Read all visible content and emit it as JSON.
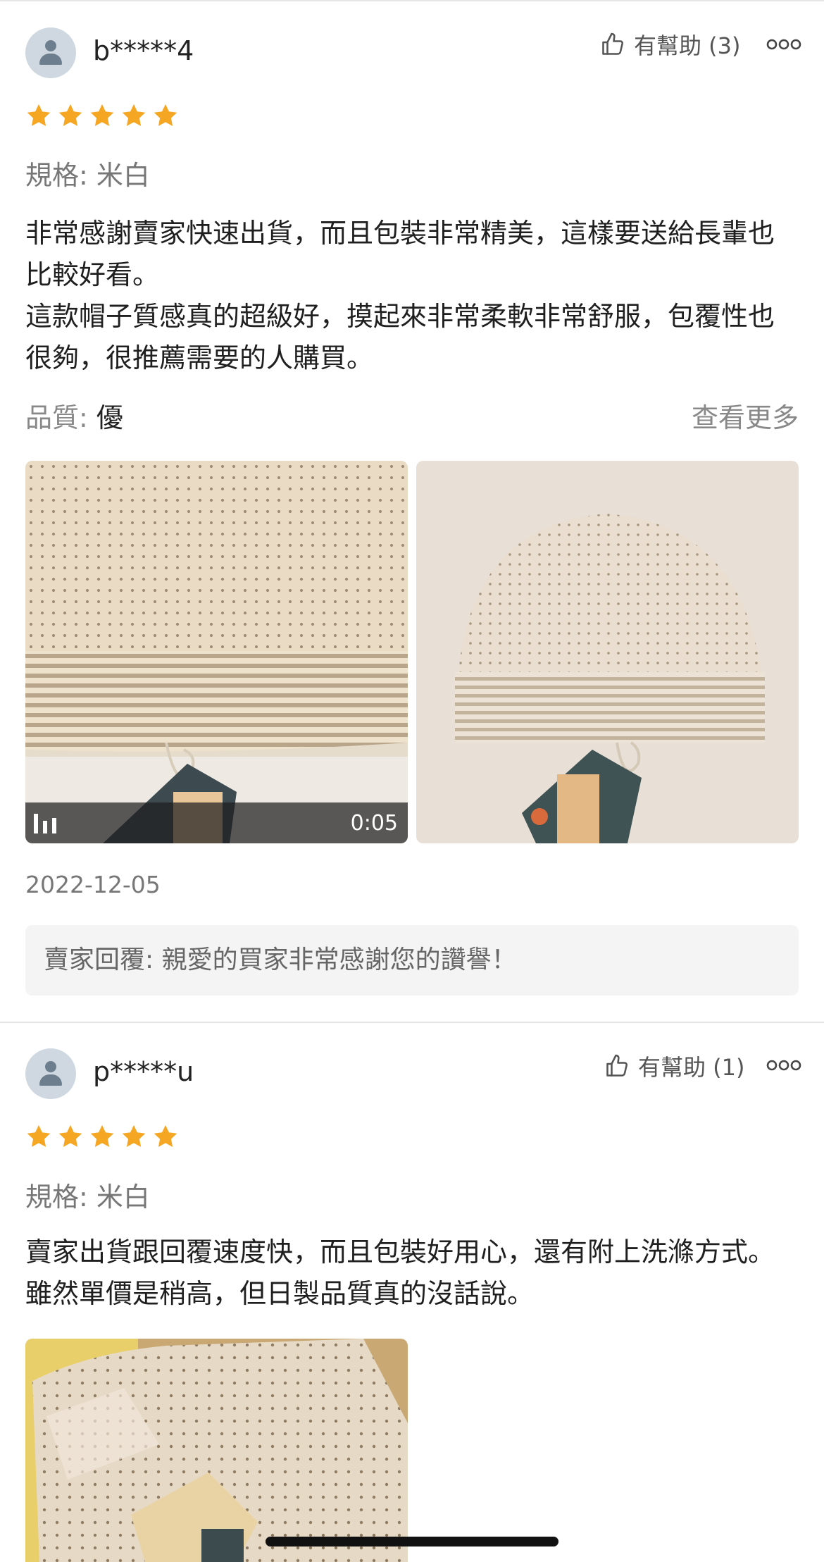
{
  "reviews": [
    {
      "username": "b*****4",
      "helpful_label": "有幫助 (3)",
      "rating": 5,
      "spec_label": "規格:",
      "spec_value": "米白",
      "paragraphs": [
        "非常感謝賣家快速出貨，而且包裝非常精美，這樣要送給長輩也比較好看。",
        "這款帽子質感真的超級好，摸起來非常柔軟非常舒服，包覆性也很夠，很推薦需要的人購買。"
      ],
      "quality_label": "品質:",
      "quality_value": "優",
      "see_more": "查看更多",
      "video_duration": "0:05",
      "date": "2022-12-05",
      "seller_reply_label": "賣家回覆:",
      "seller_reply_text": "親愛的買家非常感謝您的讚譽！"
    },
    {
      "username": "p*****u",
      "helpful_label": "有幫助 (1)",
      "rating": 5,
      "spec_label": "規格:",
      "spec_value": "米白",
      "paragraphs": [
        "賣家出貨跟回覆速度快，而且包裝好用心，還有附上洗滌方式。雖然單價是稍高，但日製品質真的沒話說。"
      ]
    }
  ],
  "colors": {
    "star": "#f5a623",
    "hat_fabric": "#eadbc4",
    "hat_dots": "#9c8a72"
  }
}
